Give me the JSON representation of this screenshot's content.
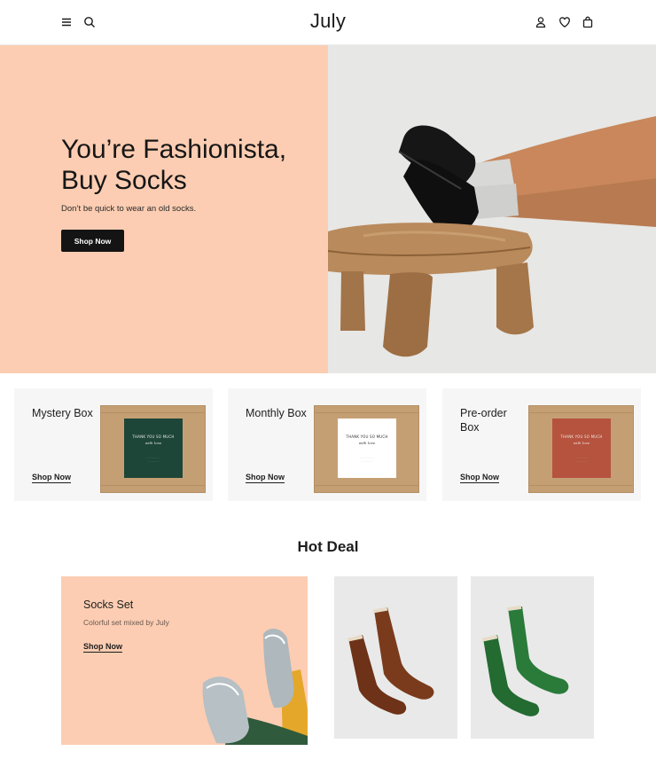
{
  "header": {
    "logo": "July",
    "icons": [
      "menu-icon",
      "search-icon",
      "user-icon",
      "heart-icon",
      "bag-icon"
    ]
  },
  "hero": {
    "title": "You’re Fashionista, Buy Socks",
    "subtitle": "Don’t be quick to wear an old socks.",
    "button_label": "Shop Now",
    "bg_color": "#fccdb2"
  },
  "boxes": [
    {
      "title": "Mystery Box",
      "link": "Shop Now",
      "insert_text": "THANK YOU SO MUCH",
      "insert_color": "#1e4638"
    },
    {
      "title": "Monthly Box",
      "link": "Shop Now",
      "insert_text": "THANK YOU SO MUCH",
      "insert_color": "#ffffff"
    },
    {
      "title": "Pre-order Box",
      "link": "Shop Now",
      "insert_text": "THANK YOU SO MUCH",
      "insert_color": "#b5533f"
    }
  ],
  "hot_deal": {
    "title": "Hot Deal",
    "featured": {
      "title": "Socks Set",
      "subtitle": "Colorful set mixed by July",
      "link": "Shop Now"
    },
    "products": [
      {
        "color": "#7a3b1c"
      },
      {
        "color": "#2a7a3a"
      }
    ]
  }
}
